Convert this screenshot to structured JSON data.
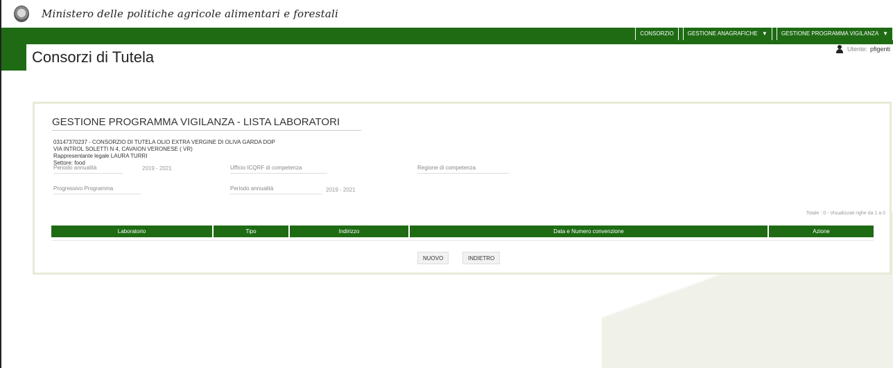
{
  "header": {
    "ministry_name": "Ministero delle politiche agricole alimentari e forestali",
    "app_title": "Consorzi di Tutela",
    "user_label": "Utente:",
    "user_name": "pfigenti"
  },
  "nav": {
    "items": [
      {
        "label": "CONSORZIO",
        "caret": ""
      },
      {
        "label": "GESTIONE ANAGRAFICHE",
        "caret": "▼"
      },
      {
        "label": "GESTIONE PROGRAMMA VIGILANZA",
        "caret": "▼"
      }
    ]
  },
  "panel": {
    "title": "GESTIONE PROGRAMMA VIGILANZA - LISTA LABORATORI",
    "info": {
      "line1": "03147370237 - CONSORZIO DI TUTELA OLIO EXTRA VERGINE DI OLIVA GARDA DOP",
      "line2": "VIA INTROL SOLETTI N 4, CAVAION VERONESE ( VR)",
      "line3": "Rappresentante legale LAURA TURRI",
      "line4": "Settore: food"
    },
    "fields": {
      "periodo1_label": "Periodo annualità",
      "periodo1_value": "2019 - 2021",
      "ufficio_label": "Ufficio ICQRF di competenza",
      "regione_label": "Regione di competenza",
      "progressivo_label": "Progressivo Programma",
      "periodo2_label": "Periodo annualità",
      "periodo2_value": "2019 - 2021"
    },
    "totale": "Totale : 0 - Visualizzati righe da 1 a 0",
    "table_columns": [
      "Laboratorio",
      "Tipo",
      "Indirizzo",
      "Data e Numero convenzione",
      "Azione"
    ],
    "buttons": {
      "nuovo": "NUOVO",
      "indietro": "INDIETRO"
    }
  },
  "colors": {
    "brand_green": "#1e6b14",
    "panel_border": "#e7ead6"
  }
}
